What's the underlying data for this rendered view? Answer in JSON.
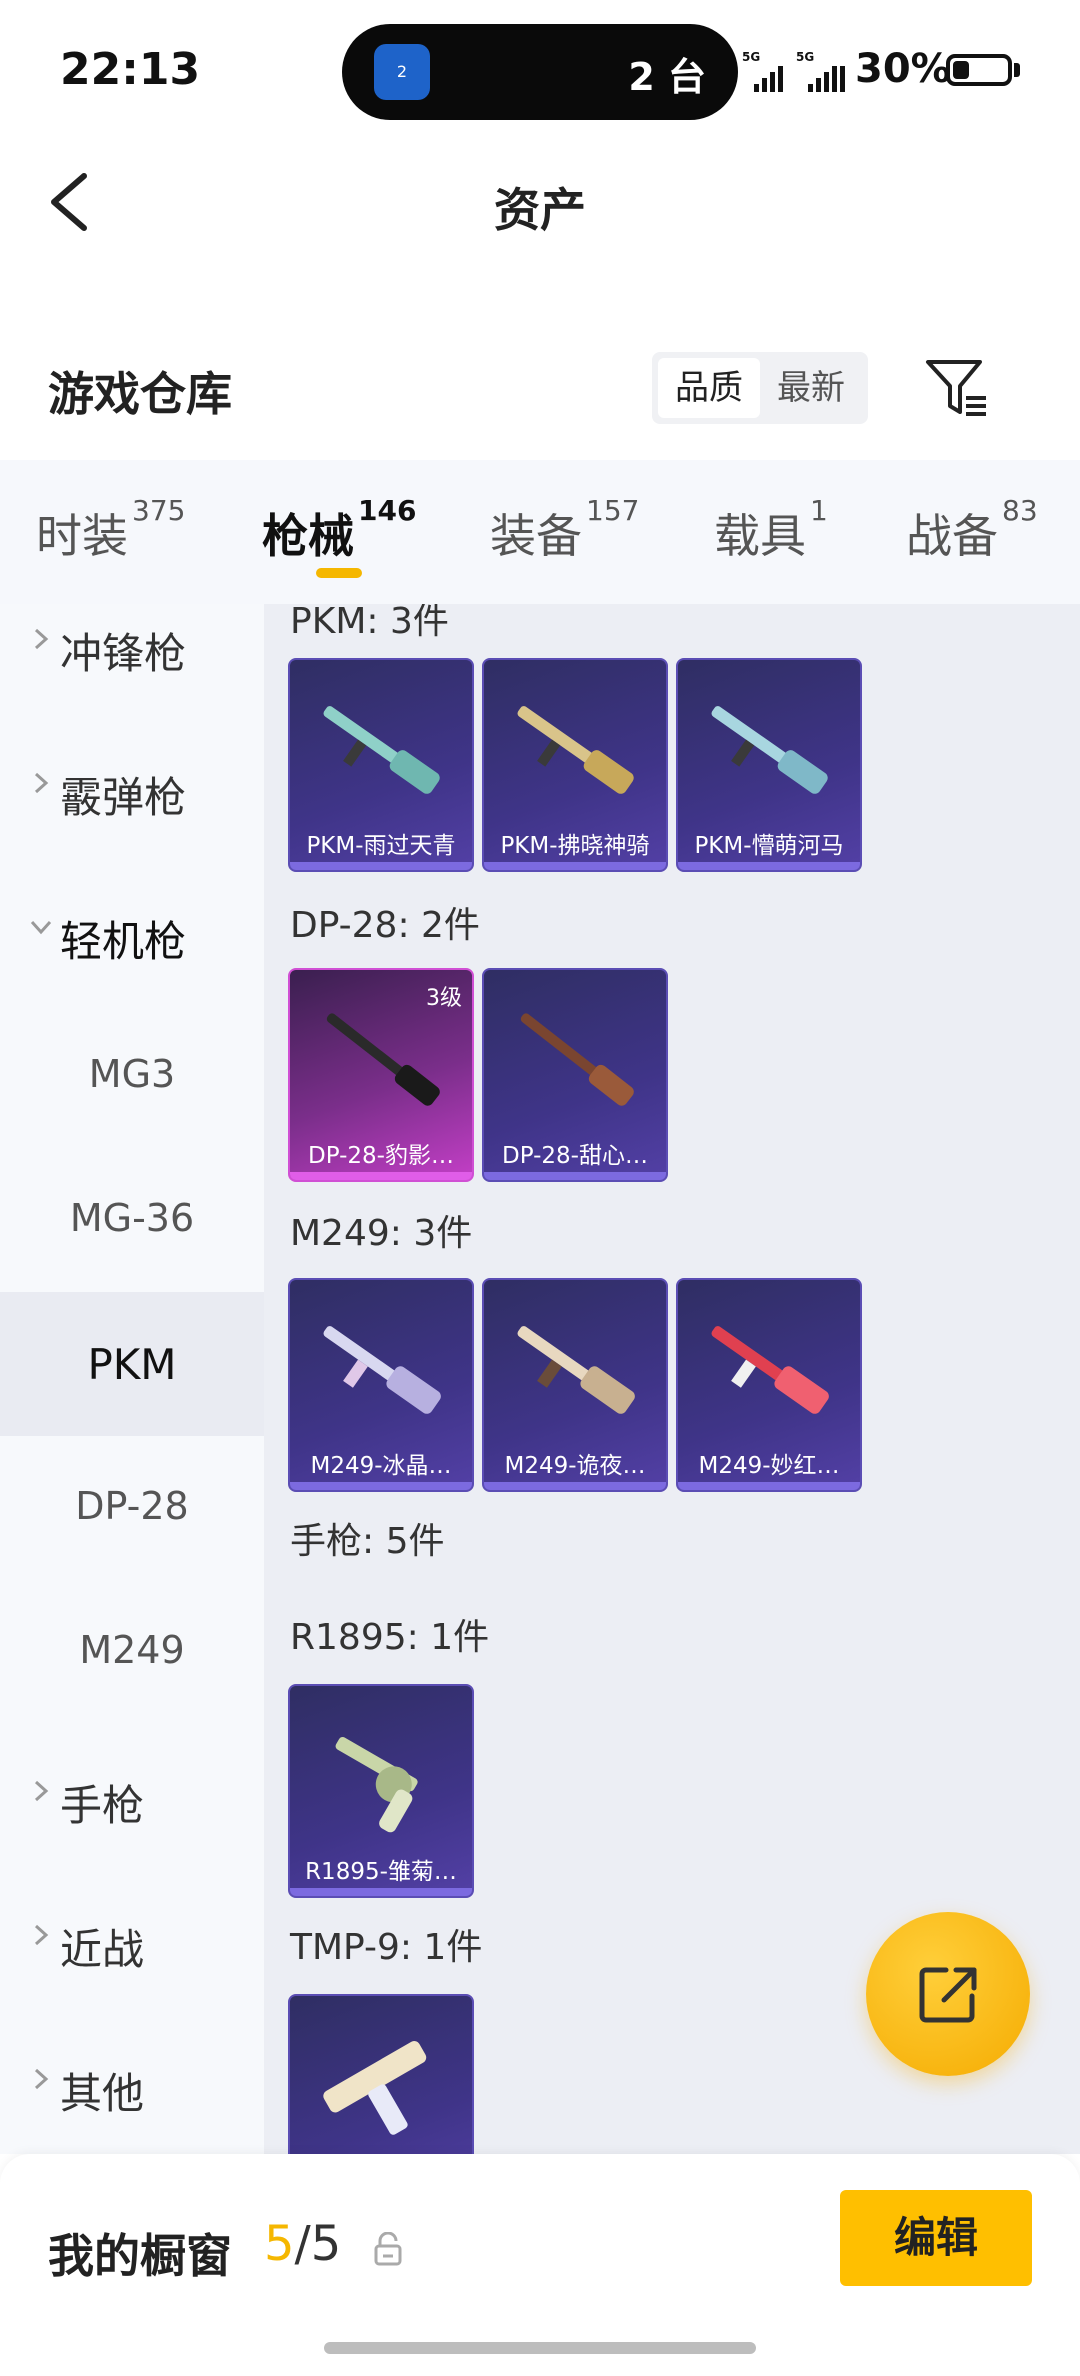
{
  "status": {
    "time": "22:13",
    "island_app_badge": "2",
    "island_text": "2 台",
    "signal1_label": "5G",
    "signal2_label": "5G",
    "battery_pct": "30%",
    "battery_level": 0.3
  },
  "header": {
    "title": "资产"
  },
  "section": {
    "title": "游戏仓库",
    "sort_options": [
      "品质",
      "最新"
    ],
    "sort_selected": "品质"
  },
  "tabs": [
    {
      "label": "时装",
      "count": "375"
    },
    {
      "label": "枪械",
      "count": "146"
    },
    {
      "label": "装备",
      "count": "157"
    },
    {
      "label": "载具",
      "count": "1"
    },
    {
      "label": "战备",
      "count": "83"
    }
  ],
  "sidebar": [
    {
      "label": "冲锋枪"
    },
    {
      "label": "霰弹枪"
    },
    {
      "label": "轻机枪"
    },
    {
      "label": "MG3"
    },
    {
      "label": "MG-36"
    },
    {
      "label": "PKM"
    },
    {
      "label": "DP-28"
    },
    {
      "label": "M249"
    },
    {
      "label": "手枪"
    },
    {
      "label": "近战"
    },
    {
      "label": "其他"
    }
  ],
  "groups": {
    "pkm": {
      "label": "PKM: 3件",
      "items": [
        {
          "name": "PKM-雨过天青"
        },
        {
          "name": "PKM-拂晓神骑"
        },
        {
          "name": "PKM-懵萌河马"
        }
      ]
    },
    "dp28": {
      "label": "DP-28: 2件",
      "items": [
        {
          "name": "DP-28-豹影…",
          "level": "3级"
        },
        {
          "name": "DP-28-甜心…"
        }
      ]
    },
    "m249": {
      "label": "M249: 3件",
      "items": [
        {
          "name": "M249-冰晶…"
        },
        {
          "name": "M249-诡夜…"
        },
        {
          "name": "M249-妙红…"
        }
      ]
    },
    "pistol": {
      "label": "手枪: 5件"
    },
    "r1895": {
      "label": "R1895: 1件",
      "items": [
        {
          "name": "R1895-雏菊…"
        }
      ]
    },
    "tmp9": {
      "label": "TMP-9: 1件"
    }
  },
  "showcase": {
    "label": "我的橱窗",
    "current": "5",
    "total": "/5",
    "edit_label": "编辑"
  },
  "colors": {
    "accent": "#f5b700",
    "card": "#3f3488",
    "card_pink": "#c43fc7"
  }
}
